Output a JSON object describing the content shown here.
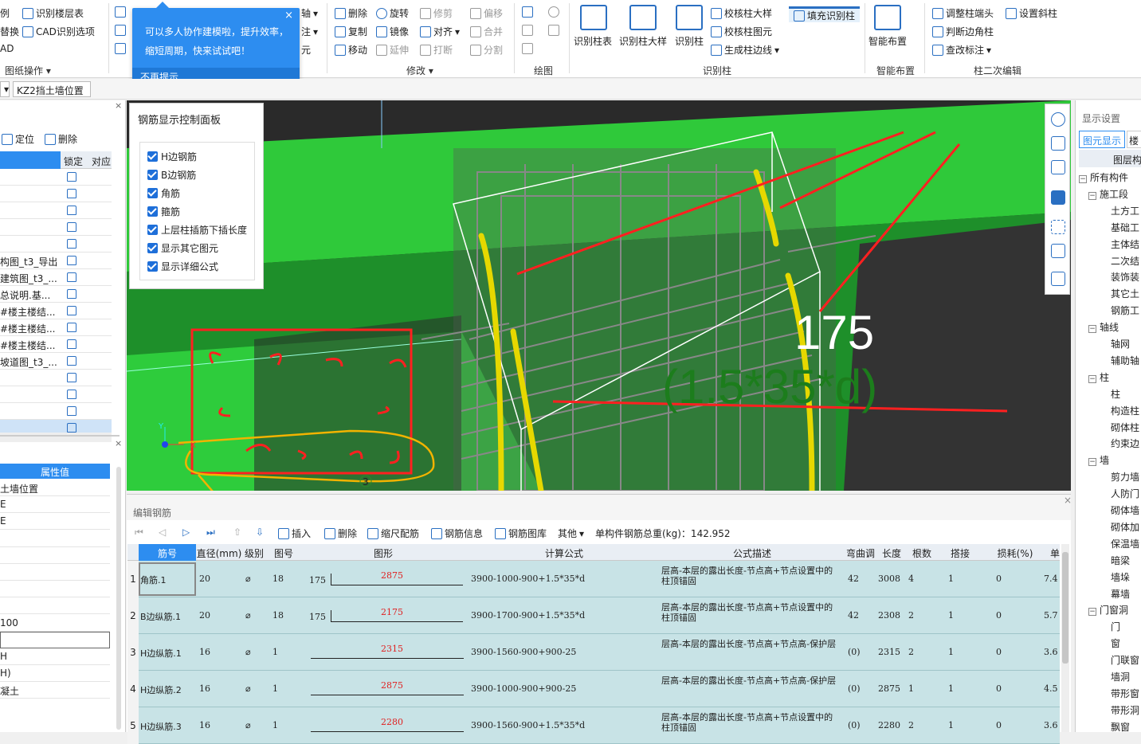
{
  "ribbon": {
    "left_col": [
      "例",
      "替换",
      "AD"
    ],
    "layer": {
      "identify_floor": "识别楼层表",
      "cad_options": "CAD识别选项"
    },
    "drawing_ops": "图纸操作",
    "axis": [
      "轴",
      "注",
      "元"
    ],
    "modify": {
      "delete": "删除",
      "rotate": "旋转",
      "trim": "修剪",
      "offset": "偏移",
      "copy": "复制",
      "mirror": "镜像",
      "align": "对齐",
      "merge": "合并",
      "move": "移动",
      "extend": "延伸",
      "break": "打断",
      "split": "分割",
      "label": "修改"
    },
    "draw_label": "绘图",
    "identify": {
      "table": "识别柱表",
      "detail": "识别柱大样",
      "column": "识别柱",
      "check_detail": "校核柱大样",
      "check_elem": "校核柱图元",
      "gen_edge": "生成柱边线",
      "fill": "填充识别柱",
      "label": "识别柱"
    },
    "smart": {
      "layout": "智能布置",
      "label": "智能布置"
    },
    "secondary": {
      "adjust_head": "调整柱端头",
      "judge_edge": "判断边角柱",
      "check_mark": "查改标注",
      "set_slant": "设置斜柱",
      "label": "柱二次编辑"
    }
  },
  "tooltip": {
    "line1": "可以多人协作建模啦，提升效率，",
    "line2": "缩短周期，快来试试吧！",
    "dismiss": "不再提示",
    "close": "×"
  },
  "toolbar2": {
    "combo": "KZ2挡土墙位置"
  },
  "left_panel": {
    "locate": "定位",
    "delete": "删除",
    "col_lock": "锁定",
    "col_corr": "对应",
    "files": [
      "构图_t3_导出",
      "建筑图_t3_...",
      "总说明.基...",
      "#楼主楼结...",
      "#楼主楼结...",
      "#楼主楼结...",
      "坡道图_t3_..."
    ],
    "prop_header": "属性值",
    "props": [
      "土墙位置",
      "E",
      "E",
      "",
      "",
      "",
      "",
      "",
      "100",
      "",
      "H",
      "H)",
      "凝土"
    ]
  },
  "control_panel": {
    "title": "钢筋显示控制面板",
    "items": [
      "H边钢筋",
      "B边钢筋",
      "角筋",
      "箍筋",
      "上层柱插筋下插长度",
      "显示其它图元",
      "显示详细公式"
    ]
  },
  "viewport": {
    "dim1": "175",
    "dim2": "(1.5*35*d)",
    "marker": "3",
    "axis_x": "X",
    "axis_y": "Y"
  },
  "right_panel": {
    "title": "显示设置",
    "tab1": "图元显示",
    "tab2": "楼",
    "header": "图层构",
    "tree": [
      {
        "t": "所有构件",
        "g": 1
      },
      {
        "t": "施工段",
        "g": 2
      },
      {
        "t": "土方工",
        "g": 0
      },
      {
        "t": "基础工",
        "g": 0
      },
      {
        "t": "主体结",
        "g": 0
      },
      {
        "t": "二次结",
        "g": 0
      },
      {
        "t": "装饰装",
        "g": 0
      },
      {
        "t": "其它土",
        "g": 0
      },
      {
        "t": "钢筋工",
        "g": 0
      },
      {
        "t": "轴线",
        "g": 2
      },
      {
        "t": "轴网",
        "g": 0
      },
      {
        "t": "辅助轴",
        "g": 0
      },
      {
        "t": "柱",
        "g": 2
      },
      {
        "t": "柱",
        "g": 0
      },
      {
        "t": "构造柱",
        "g": 0
      },
      {
        "t": "砌体柱",
        "g": 0
      },
      {
        "t": "约束边",
        "g": 0
      },
      {
        "t": "墙",
        "g": 2
      },
      {
        "t": "剪力墙",
        "g": 0
      },
      {
        "t": "人防门",
        "g": 0
      },
      {
        "t": "砌体墙",
        "g": 0
      },
      {
        "t": "砌体加",
        "g": 0
      },
      {
        "t": "保温墙",
        "g": 0
      },
      {
        "t": "暗梁",
        "g": 0
      },
      {
        "t": "墙垛",
        "g": 0
      },
      {
        "t": "幕墙",
        "g": 0
      },
      {
        "t": "门窗洞",
        "g": 2
      },
      {
        "t": "门",
        "g": 0
      },
      {
        "t": "窗",
        "g": 0
      },
      {
        "t": "门联窗",
        "g": 0
      },
      {
        "t": "墙洞",
        "g": 0
      },
      {
        "t": "带形窗",
        "g": 0
      },
      {
        "t": "带形洞",
        "g": 0
      },
      {
        "t": "飘窗",
        "g": 0
      }
    ]
  },
  "edit": {
    "title": "编辑钢筋",
    "toolbar": {
      "insert": "插入",
      "delete": "删除",
      "scale": "缩尺配筋",
      "info": "钢筋信息",
      "lib": "钢筋图库",
      "other": "其他",
      "total": "单构件钢筋总重(kg)：142.952"
    },
    "headers": [
      "筋号",
      "直径(mm)",
      "级别",
      "图号",
      "图形",
      "计算公式",
      "公式描述",
      "弯曲调整",
      "长度",
      "根数",
      "搭接",
      "损耗(%)",
      "单"
    ],
    "rows": [
      {
        "n": "1",
        "name": "角筋.1",
        "d": "20",
        "lv": "⌀",
        "fig": "18",
        "pre": "175",
        "len_label": "2875",
        "formula": "3900-1000-900+1.5*35*d",
        "desc": "层高-本层的露出长度-节点高+节点设置中的柱顶锚固",
        "bend": "42",
        "length": "3008",
        "count": "4",
        "lap": "1",
        "loss": "0",
        "unit": "7.4"
      },
      {
        "n": "2",
        "name": "B边纵筋.1",
        "d": "20",
        "lv": "⌀",
        "fig": "18",
        "pre": "175",
        "len_label": "2175",
        "formula": "3900-1700-900+1.5*35*d",
        "desc": "层高-本层的露出长度-节点高+节点设置中的柱顶锚固",
        "bend": "42",
        "length": "2308",
        "count": "2",
        "lap": "1",
        "loss": "0",
        "unit": "5.7"
      },
      {
        "n": "3",
        "name": "H边纵筋.1",
        "d": "16",
        "lv": "⌀",
        "fig": "1",
        "pre": "",
        "len_label": "2315",
        "formula": "3900-1560-900+900-25",
        "desc": "层高-本层的露出长度-节点高+节点高-保护层",
        "bend": "(0)",
        "length": "2315",
        "count": "2",
        "lap": "1",
        "loss": "0",
        "unit": "3.6"
      },
      {
        "n": "4",
        "name": "H边纵筋.2",
        "d": "16",
        "lv": "⌀",
        "fig": "1",
        "pre": "",
        "len_label": "2875",
        "formula": "3900-1000-900+900-25",
        "desc": "层高-本层的露出长度-节点高+节点高-保护层",
        "bend": "(0)",
        "length": "2875",
        "count": "1",
        "lap": "1",
        "loss": "0",
        "unit": "4.5"
      },
      {
        "n": "5",
        "name": "H边纵筋.3",
        "d": "16",
        "lv": "⌀",
        "fig": "1",
        "pre": "",
        "len_label": "2280",
        "formula": "3900-1560-900+1.5*35*d",
        "desc": "层高-本层的露出长度-节点高+节点设置中的柱顶锚固",
        "bend": "(0)",
        "length": "2280",
        "count": "2",
        "lap": "1",
        "loss": "0",
        "unit": "3.6"
      }
    ]
  }
}
